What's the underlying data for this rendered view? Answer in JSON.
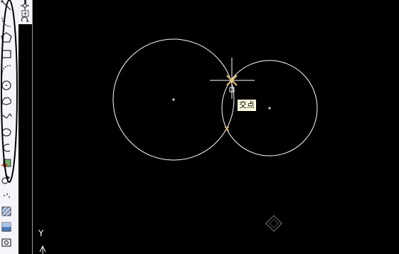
{
  "toolbar": {
    "tools": [
      {
        "name": "line-tool-icon"
      },
      {
        "name": "polyline-tool-icon"
      },
      {
        "name": "polygon-tool-icon"
      },
      {
        "name": "rectangle-tool-icon"
      },
      {
        "name": "arc-tool-icon"
      },
      {
        "name": "circle-tool-icon"
      },
      {
        "name": "revision-cloud-tool-icon"
      },
      {
        "name": "spline-tool-icon"
      },
      {
        "name": "ellipse-tool-icon"
      },
      {
        "name": "ellipse-arc-tool-icon"
      },
      {
        "name": "insert-block-tool-icon"
      },
      {
        "name": "make-block-tool-icon"
      },
      {
        "name": "point-tool-icon"
      },
      {
        "name": "hatch-tool-icon"
      },
      {
        "name": "gradient-tool-icon"
      },
      {
        "name": "region-tool-icon"
      }
    ]
  },
  "snap": {
    "tooltip": "交点"
  },
  "ucs": {
    "y_label": "Y"
  },
  "colors": {
    "canvas_background": "#000000",
    "geometry": "#ffffff",
    "snap_marker": "#e8c070",
    "tooltip_background": "#ffffe1",
    "annotation_ellipse": "#000000",
    "toolbar_background": "#f4f4fa"
  }
}
